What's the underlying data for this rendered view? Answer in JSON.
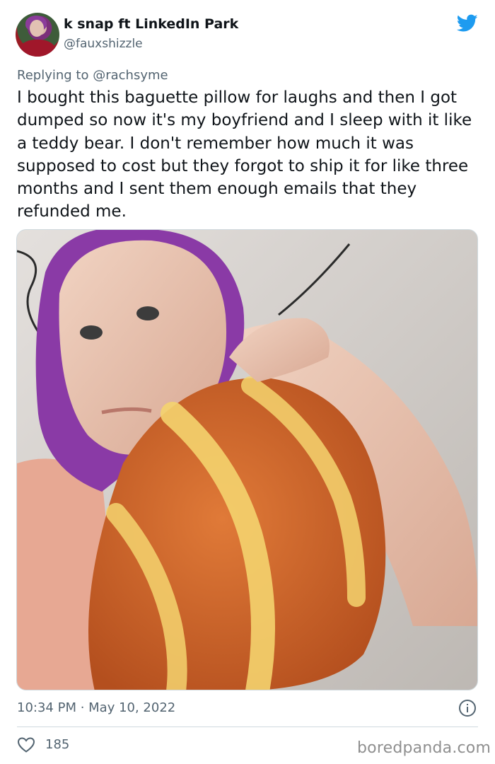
{
  "tweet": {
    "display_name": "k snap ft LinkedIn Park",
    "handle": "@fauxshizzle",
    "reply_prefix": "Replying to ",
    "reply_to": "@rachsyme",
    "text": "I bought this baguette pillow for laughs and then I got dumped so now it's my boyfriend and I sleep with it like a teddy bear. I don't remember how much it was supposed to cost but they forgot to ship it for like three months and I sent them enough emails that they refunded me.",
    "timestamp": "10:34 PM · May 10, 2022",
    "like_count": "185"
  },
  "watermark": "boredpanda.com",
  "icons": {
    "logo": "twitter-bird-icon",
    "info": "info-icon",
    "like": "heart-icon"
  },
  "colors": {
    "twitter_blue": "#1d9bf0",
    "text_primary": "#0f1419",
    "text_secondary": "#536471",
    "divider": "#cfd9de"
  }
}
